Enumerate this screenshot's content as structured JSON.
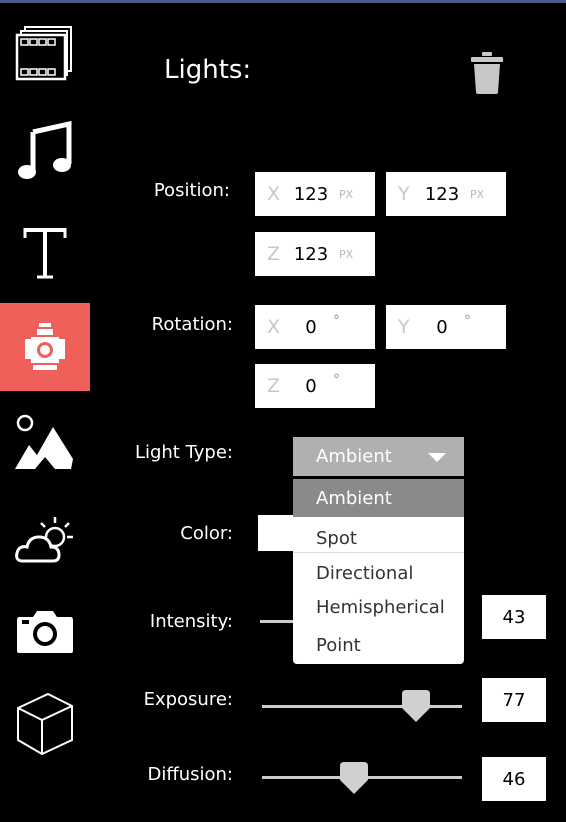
{
  "sidebar": {
    "items": [
      {
        "icon": "film-strip-icon"
      },
      {
        "icon": "music-icon"
      },
      {
        "icon": "text-icon"
      },
      {
        "icon": "spotlight-icon",
        "active": true
      },
      {
        "icon": "landscape-icon"
      },
      {
        "icon": "weather-icon"
      },
      {
        "icon": "camera-icon"
      },
      {
        "icon": "cube-icon"
      }
    ],
    "active_color": "#f0605a"
  },
  "panel": {
    "title": "Lights:",
    "position": {
      "label": "Position:",
      "x": {
        "axis": "X",
        "value": "123",
        "unit": "PX"
      },
      "y": {
        "axis": "Y",
        "value": "123",
        "unit": "PX"
      },
      "z": {
        "axis": "Z",
        "value": "123",
        "unit": "PX"
      }
    },
    "rotation": {
      "label": "Rotation:",
      "x": {
        "axis": "X",
        "value": "0",
        "unit": "°"
      },
      "y": {
        "axis": "Y",
        "value": "0",
        "unit": "°"
      },
      "z": {
        "axis": "Z",
        "value": "0",
        "unit": "°"
      }
    },
    "light_type": {
      "label": "Light Type:",
      "selected": "Ambient",
      "options": [
        "Ambient",
        "Spot",
        "Directional",
        "Hemispherical",
        "Point"
      ]
    },
    "color": {
      "label": "Color:",
      "value": "#ffffff"
    },
    "intensity": {
      "label": "Intensity:",
      "value": "43",
      "fraction": 0.43
    },
    "exposure": {
      "label": "Exposure:",
      "value": "77",
      "fraction": 0.77
    },
    "diffusion": {
      "label": "Diffusion:",
      "value": "46",
      "fraction": 0.46
    }
  }
}
